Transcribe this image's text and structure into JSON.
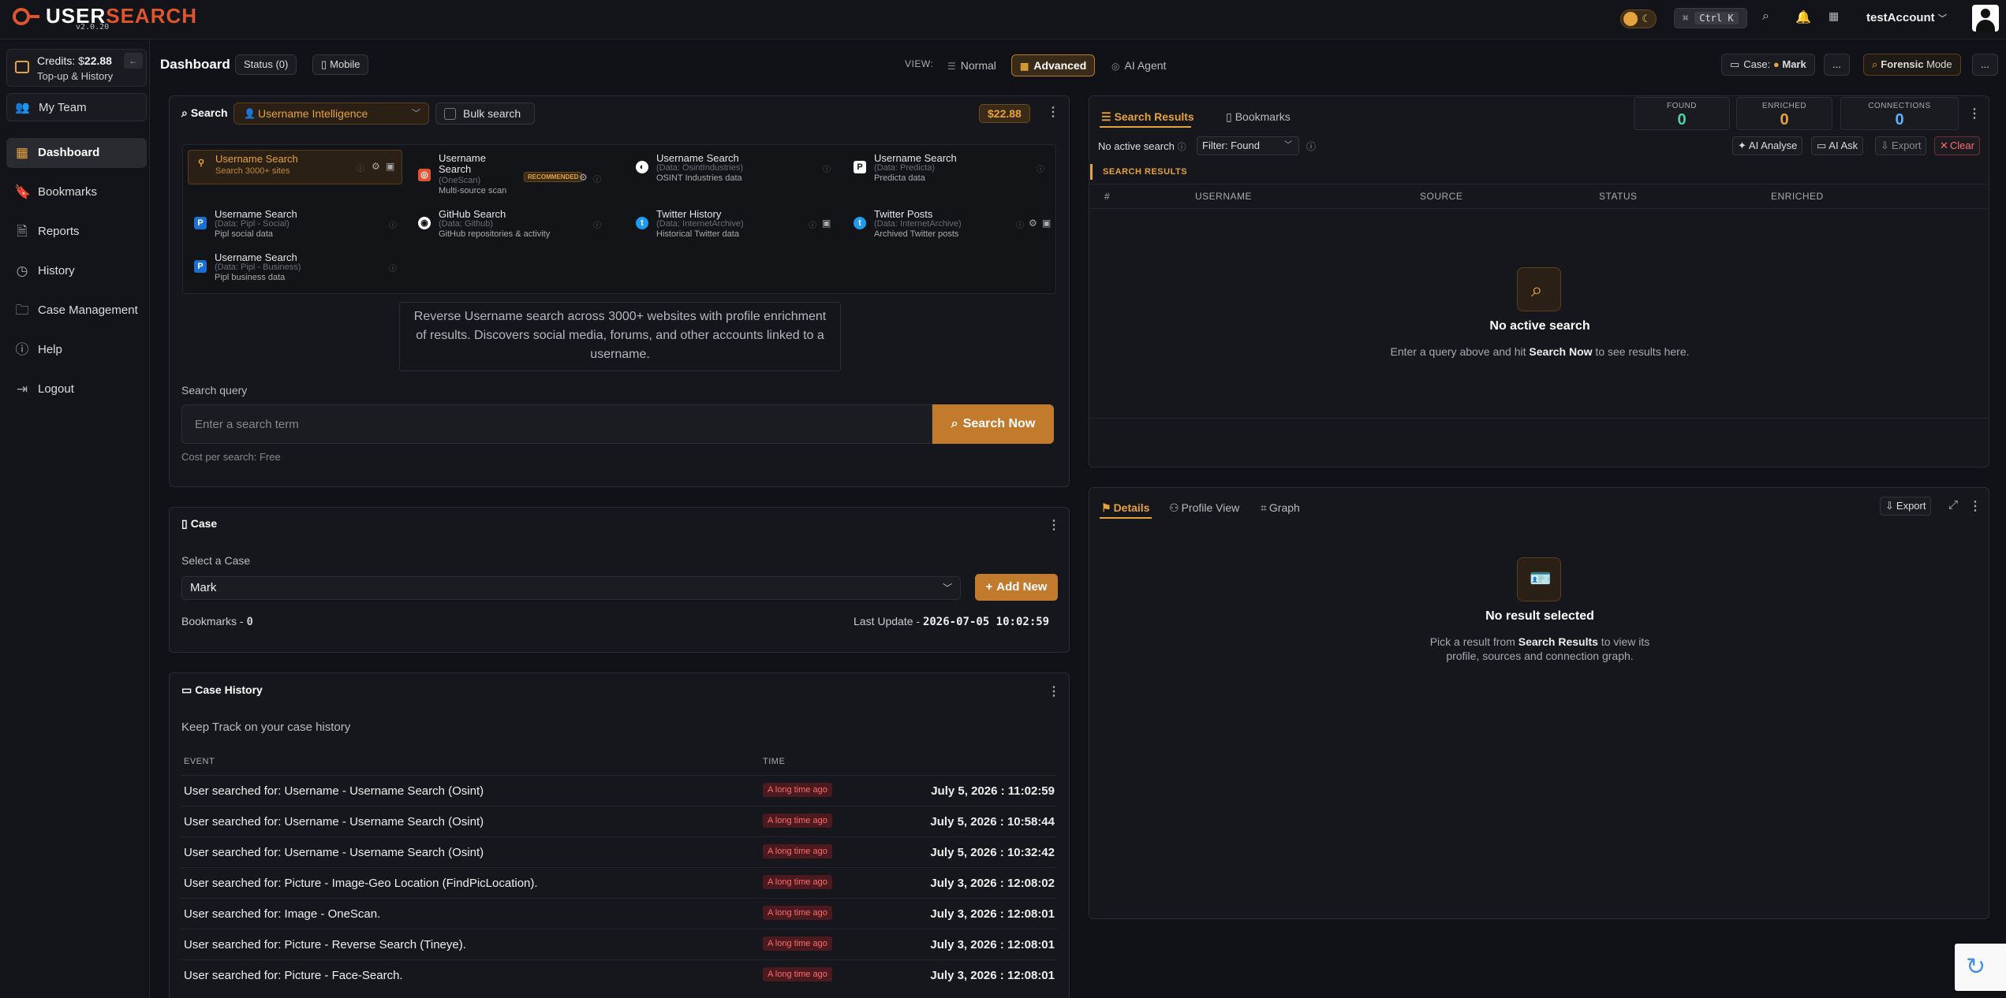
{
  "header": {
    "logo_a": "USER",
    "logo_b": "SEARCH",
    "version": "v2.0.20",
    "shortcut_cmd": "⌘",
    "shortcut_key": "Ctrl K",
    "account": "testAccount"
  },
  "sidebar": {
    "credits_label": "Credits: $",
    "credits_value": "22.88",
    "topup": "Top-up & History",
    "team": "My Team",
    "items": [
      {
        "label": "Dashboard",
        "icon": "grid-icon"
      },
      {
        "label": "Bookmarks",
        "icon": "bookmark-icon"
      },
      {
        "label": "Reports",
        "icon": "document-icon"
      },
      {
        "label": "History",
        "icon": "clock-icon"
      },
      {
        "label": "Case Management",
        "icon": "folder-icon"
      },
      {
        "label": "Help",
        "icon": "help-icon"
      },
      {
        "label": "Logout",
        "icon": "logout-icon"
      }
    ]
  },
  "toolbar": {
    "title": "Dashboard",
    "status": "Status (0)",
    "mobile": "Mobile",
    "view_label": "VIEW:",
    "views": [
      "Normal",
      "Advanced",
      "AI Agent"
    ],
    "case_label": "Case:",
    "case_name": "Mark",
    "more": "...",
    "forensic": "Forensic",
    "mode": "Mode"
  },
  "search_panel": {
    "title": "Search",
    "category": "Username Intelligence",
    "bulk": "Bulk search",
    "price": "$22.88",
    "modules": [
      {
        "title": "Username Search",
        "desc": "Search 3000+ sites"
      },
      {
        "title": "Username",
        "title2": "Search",
        "source": "(OneScan)",
        "desc": "Multi-source scan",
        "badge": "RECOMMENDED"
      },
      {
        "title": "Username Search",
        "source": "(Data: OsintIndustries)",
        "desc": "OSINT Industries data"
      },
      {
        "title": "Username Search",
        "source": "(Data: Predicta)",
        "desc": "Predicta data"
      },
      {
        "title": "Username Search",
        "source": "(Data: Pipl - Social)",
        "desc": "Pipl social data"
      },
      {
        "title": "GitHub Search",
        "source": "(Data: Github)",
        "desc": "GitHub repositories & activity"
      },
      {
        "title": "Twitter History",
        "source": "(Data: InternetArchive)",
        "desc": "Historical Twitter data"
      },
      {
        "title": "Twitter Posts",
        "source": "(Data: InternetArchive)",
        "desc": "Archived Twitter posts"
      },
      {
        "title": "Username Search",
        "source": "(Data: Pipl - Business)",
        "desc": "Pipl business data"
      }
    ],
    "description": "Reverse Username search across 3000+ websites with profile enrichment of results. Discovers social media, forums, and other accounts linked to a username.",
    "query_label": "Search query",
    "query_placeholder": "Enter a search term",
    "search_btn": "Search Now",
    "cost": "Cost per search: Free"
  },
  "case_panel": {
    "title": "Case",
    "select_label": "Select a Case",
    "selected": "Mark",
    "add_new": "Add New",
    "bookmarks_label": "Bookmarks -",
    "bookmarks_value": "0",
    "last_update_label": "Last Update -",
    "last_update_value": "2026-07-05 10:02:59"
  },
  "history_panel": {
    "title": "Case History",
    "subtitle": "Keep Track on your case history",
    "col_event": "EVENT",
    "col_time": "TIME",
    "rows": [
      {
        "event": "User searched for: Username - Username Search (Osint)",
        "badge": "A long time ago",
        "time": "July 5, 2026 : 11:02:59"
      },
      {
        "event": "User searched for: Username - Username Search (Osint)",
        "badge": "A long time ago",
        "time": "July 5, 2026 : 10:58:44"
      },
      {
        "event": "User searched for: Username - Username Search (Osint)",
        "badge": "A long time ago",
        "time": "July 5, 2026 : 10:32:42"
      },
      {
        "event": "User searched for: Picture - Image-Geo Location (FindPicLocation).",
        "badge": "A long time ago",
        "time": "July 3, 2026 : 12:08:02"
      },
      {
        "event": "User searched for: Image - OneScan.",
        "badge": "A long time ago",
        "time": "July 3, 2026 : 12:08:01"
      },
      {
        "event": "User searched for: Picture - Reverse Search (Tineye).",
        "badge": "A long time ago",
        "time": "July 3, 2026 : 12:08:01"
      },
      {
        "event": "User searched for: Picture - Face-Search.",
        "badge": "A long time ago",
        "time": "July 3, 2026 : 12:08:01"
      }
    ]
  },
  "results_panel": {
    "tab_results": "Search Results",
    "tab_bookmarks": "Bookmarks",
    "stats": [
      {
        "label": "FOUND",
        "value": "0",
        "color": "#4fd1a5"
      },
      {
        "label": "ENRICHED",
        "value": "0",
        "color": "#e6a23c"
      },
      {
        "label": "CONNECTIONS",
        "value": "0",
        "color": "#5ab0ff"
      }
    ],
    "no_active": "No active search",
    "filter": "Filter: Found",
    "ai_analyse": "AI Analyse",
    "ai_ask": "AI Ask",
    "export": "Export",
    "clear": "Clear",
    "section": "SEARCH RESULTS",
    "cols": [
      "#",
      "USERNAME",
      "SOURCE",
      "STATUS",
      "ENRICHED"
    ],
    "empty_title": "No active search",
    "empty_pre": "Enter a query above and hit ",
    "empty_bold": "Search Now",
    "empty_post": " to see results here."
  },
  "details_panel": {
    "tabs": [
      "Details",
      "Profile View",
      "Graph"
    ],
    "export": "Export",
    "empty_title": "No result selected",
    "empty_pre": "Pick a result from ",
    "empty_bold": "Search Results",
    "empty_post": " to view its",
    "empty_line2": "profile, sources and connection graph."
  }
}
